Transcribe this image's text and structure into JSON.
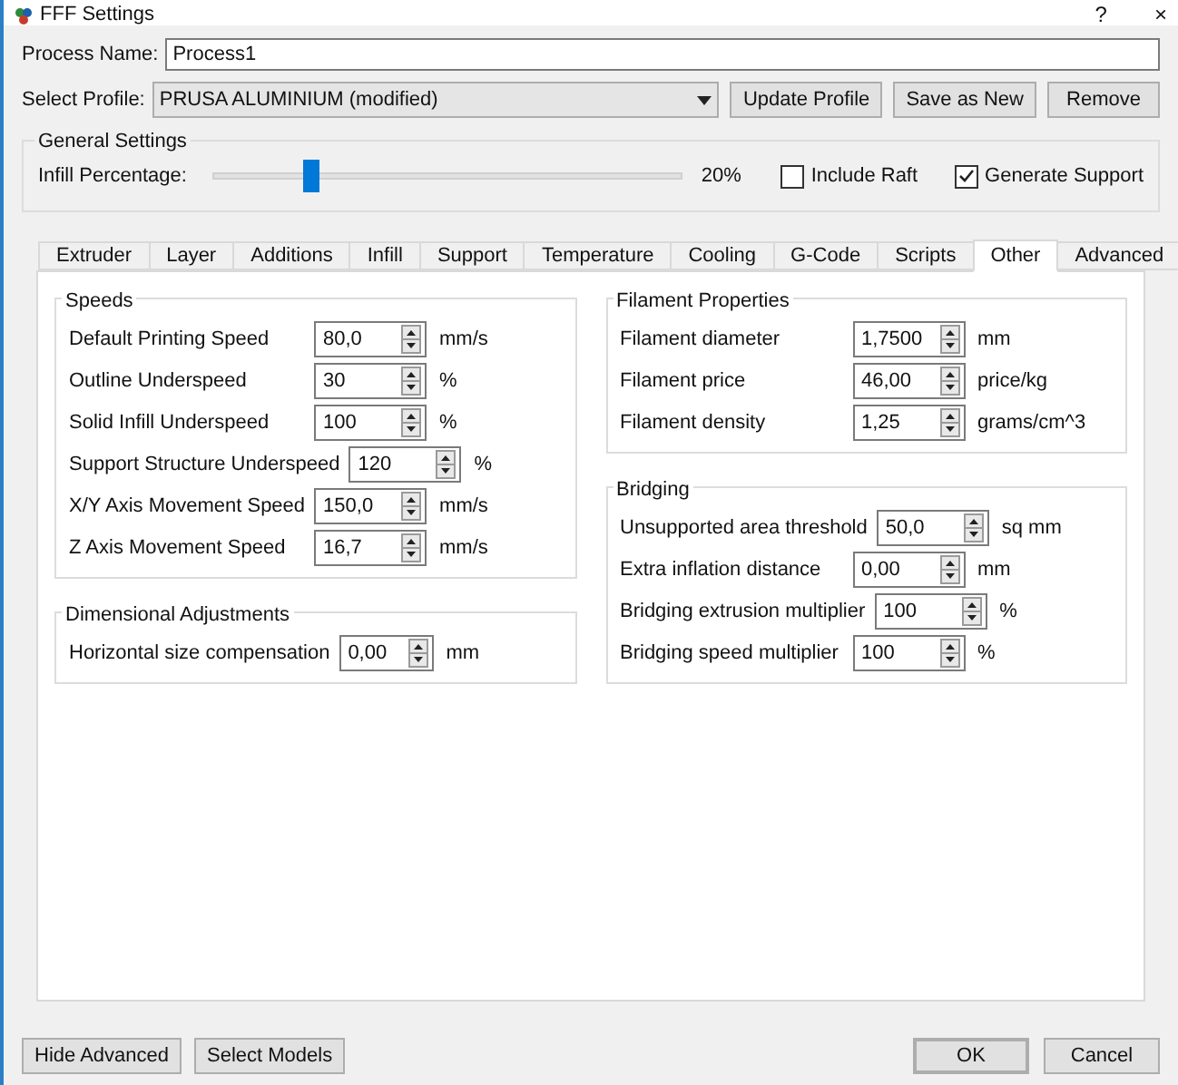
{
  "window": {
    "title": "FFF Settings",
    "buttons": [
      "?",
      "×"
    ]
  },
  "process_name": {
    "label": "Process Name:",
    "value": "Process1"
  },
  "profile": {
    "label": "Select Profile:",
    "value": "PRUSA ALUMINIUM (modified)",
    "buttons": [
      "Update Profile",
      "Save as New",
      "Remove"
    ]
  },
  "general_settings": {
    "title": "General Settings",
    "infill": {
      "label": "Infill Percentage:",
      "level": 0.21,
      "reading": "20%"
    },
    "checkboxes": [
      {
        "label": "Include Raft",
        "checked": false
      },
      {
        "label": "Generate Support",
        "checked": true
      }
    ]
  },
  "tabs": [
    {
      "label": "Extruder",
      "selected": false
    },
    {
      "label": "Layer",
      "selected": false
    },
    {
      "label": "Additions",
      "selected": false
    },
    {
      "label": "Infill",
      "selected": false
    },
    {
      "label": "Support",
      "selected": false
    },
    {
      "label": "Temperature",
      "selected": false
    },
    {
      "label": "Cooling",
      "selected": false
    },
    {
      "label": "G-Code",
      "selected": false
    },
    {
      "label": "Scripts",
      "selected": false
    },
    {
      "label": "Other",
      "selected": true
    },
    {
      "label": "Advanced",
      "selected": false
    }
  ],
  "left_groups": [
    {
      "title": "Speeds",
      "kind": "grid",
      "rows": [
        {
          "label": "Default Printing Speed",
          "value": "80,0",
          "unit": "mm/s"
        },
        {
          "label": "Outline Underspeed",
          "value": "30",
          "unit": "%"
        },
        {
          "label": "Solid Infill Underspeed",
          "value": "100",
          "unit": "%"
        },
        {
          "label": "Support Structure Underspeed",
          "value": "120",
          "unit": "%"
        },
        {
          "label": "X/Y Axis Movement Speed",
          "value": "150,0",
          "unit": "mm/s"
        },
        {
          "label": "Z Axis Movement Speed",
          "value": "16,7",
          "unit": "mm/s"
        }
      ]
    },
    {
      "title": "Dimensional Adjustments",
      "kind": "inline",
      "rows": [
        {
          "label": "Horizontal size compensation",
          "value": "0,00",
          "unit": "mm"
        }
      ]
    }
  ],
  "right_groups": [
    {
      "title": "Filament Properties",
      "kind": "grid",
      "rows": [
        {
          "label": "Filament diameter",
          "value": "1,7500",
          "unit": "mm"
        },
        {
          "label": "Filament price",
          "value": "46,00",
          "unit": "price/kg"
        },
        {
          "label": "Filament density",
          "value": "1,25",
          "unit": "grams/cm^3"
        }
      ]
    },
    {
      "title": "Bridging",
      "kind": "grid",
      "rows": [
        {
          "label": "Unsupported area threshold",
          "value": "50,0",
          "unit": "sq mm"
        },
        {
          "label": "Extra inflation distance",
          "value": "0,00",
          "unit": "mm"
        },
        {
          "label": "Bridging extrusion multiplier",
          "value": "100",
          "unit": "%"
        },
        {
          "label": "Bridging speed multiplier",
          "value": "100",
          "unit": "%"
        }
      ]
    }
  ],
  "footer": {
    "left_buttons": [
      {
        "label": "Hide Advanced",
        "default": false
      },
      {
        "label": "Select Models",
        "default": false
      }
    ],
    "right_buttons": [
      {
        "label": "OK",
        "default": true
      },
      {
        "label": "Cancel",
        "default": false
      }
    ]
  }
}
